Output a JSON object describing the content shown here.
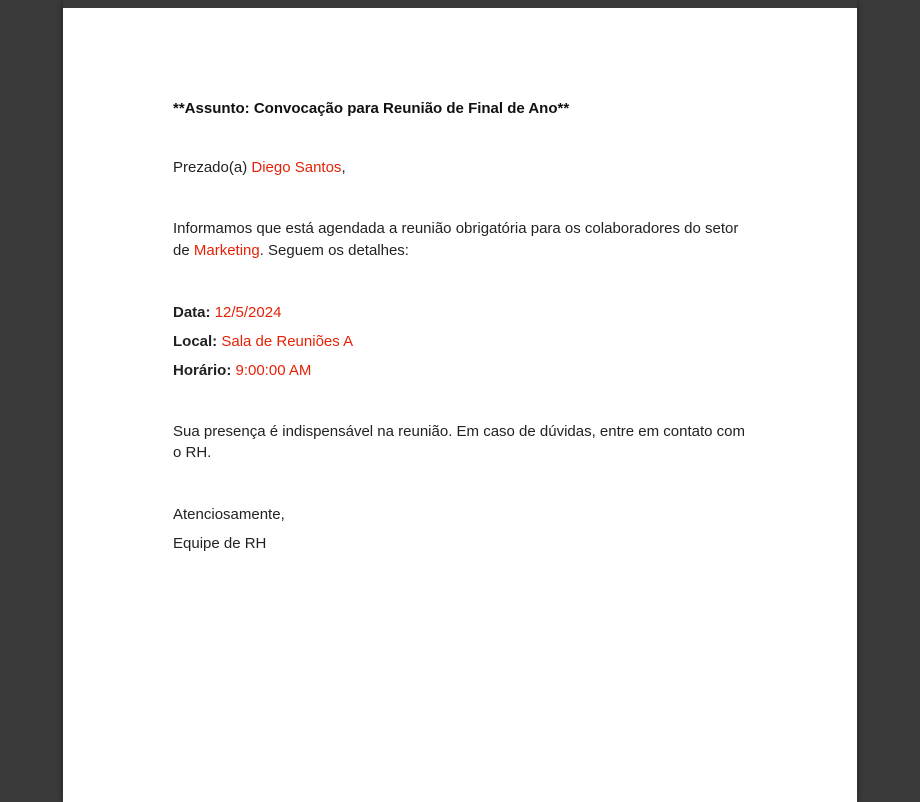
{
  "subject_line": "**Assunto: Convocação para Reunião de Final de Ano**",
  "greeting_prefix": "Prezado(a) ",
  "recipient_name": "Diego Santos",
  "greeting_suffix": ",",
  "intro_part1": "Informamos que está agendada a reunião obrigatória para os colaboradores do setor de ",
  "department": "Marketing",
  "intro_part2": ". Seguem os detalhes:",
  "details": {
    "date_label": "Data: ",
    "date_value": "12/5/2024",
    "location_label": "Local: ",
    "location_value": "Sala de Reuniões A",
    "time_label": "Horário: ",
    "time_value": "9:00:00 AM"
  },
  "closing_note": "Sua presença é indispensável na reunião. Em caso de dúvidas, entre em contato com o RH.",
  "sign_off": "Atenciosamente,",
  "signature": "Equipe de RH"
}
